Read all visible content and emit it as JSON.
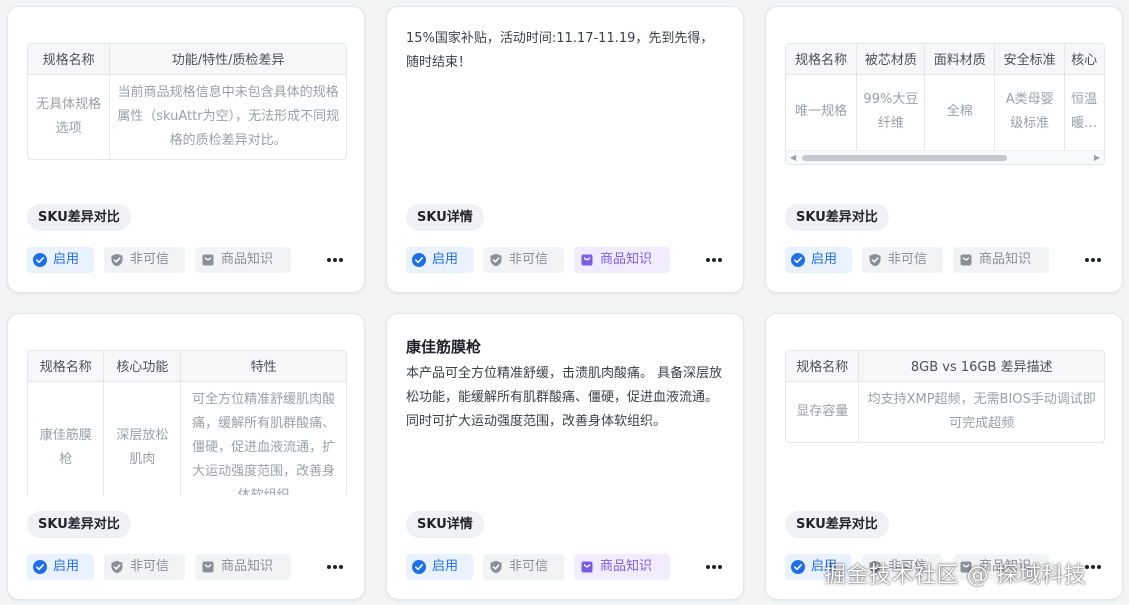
{
  "common": {
    "tag_enable": "启用",
    "tag_untrusted": "非可信",
    "tag_knowledge": "商品知识",
    "label_sku_diff": "SKU差异对比",
    "label_sku_detail": "SKU详情"
  },
  "card1": {
    "headers": [
      "规格名称",
      "功能/特性/质检差异"
    ],
    "row": [
      "无具体规格选项",
      "当前商品规格信息中未包含具体的规格属性（skuAttr为空），无法形成不同规格的质检差异对比。"
    ]
  },
  "card2": {
    "text": "15%国家补贴，活动时间:11.17-11.19，先到先得，随时结束！"
  },
  "card3": {
    "headers": [
      "规格名称",
      "被芯材质",
      "面料材质",
      "安全标准",
      "核心"
    ],
    "row": [
      "唯一规格",
      "99%大豆纤维",
      "全棉",
      "A类母婴级标准",
      "恒温暖…"
    ]
  },
  "card4": {
    "headers": [
      "规格名称",
      "核心功能",
      "特性"
    ],
    "row": [
      "康佳筋膜枪",
      "深层放松肌肉",
      "可全方位精准舒缓肌肉酸痛，缓解所有肌群酸痛、僵硬，促进血液流通，扩大运动强度范围，改善身体软组织"
    ]
  },
  "card5": {
    "title": "康佳筋膜枪",
    "text": "本产品可全方位精准舒缓，击溃肌肉酸痛。 具备深层放松功能，能缓解所有肌群酸痛、僵硬，促进血液流通。 同时可扩大运动强度范围，改善身体软组织。"
  },
  "card6": {
    "headers": [
      "规格名称",
      "8GB vs 16GB 差异描述"
    ],
    "row": [
      "显存容量",
      "均支持XMP超频，无需BIOS手动调试即可完成超频"
    ]
  },
  "watermark": "掘金技术社区 @ 探域科技",
  "colors": {
    "accent_blue": "#1f6feb",
    "accent_purple": "#7b5ce6"
  }
}
